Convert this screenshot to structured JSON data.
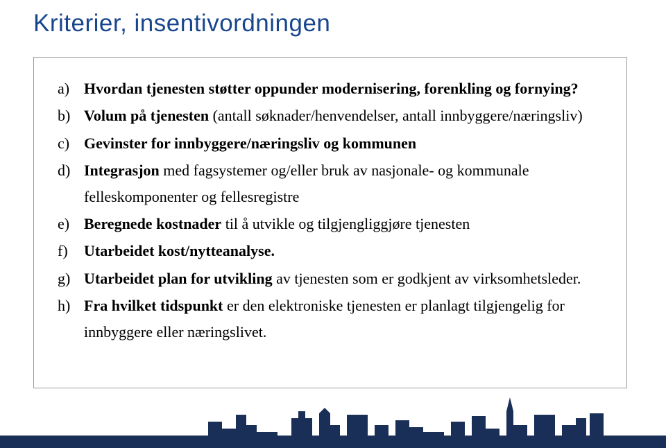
{
  "title": "Kriterier, insentivordningen",
  "items": [
    {
      "marker": "a)",
      "prefix": "",
      "bold": "Hvordan tjenesten støtter oppunder modernisering, forenkling og fornying?",
      "suffix": ""
    },
    {
      "marker": "b)",
      "prefix": "",
      "bold": "Volum på tjenesten",
      "suffix": " (antall søknader/henvendelser, antall innbyggere/næringsliv)"
    },
    {
      "marker": "c)",
      "prefix": "",
      "bold": "Gevinster for innbyggere/næringsliv og kommunen",
      "suffix": ""
    },
    {
      "marker": "d)",
      "prefix": "",
      "bold": "Integrasjon",
      "suffix": " med fagsystemer og/eller bruk av nasjonale- og kommunale felleskomponenter og fellesregistre"
    },
    {
      "marker": "e)",
      "prefix": "",
      "bold": "Beregnede kostnader",
      "suffix": " til å utvikle og tilgjengliggjøre tjenesten"
    },
    {
      "marker": "f)",
      "prefix": "",
      "bold": "Utarbeidet kost/nytteanalyse.",
      "suffix": ""
    },
    {
      "marker": "g)",
      "prefix": "",
      "bold": "Utarbeidet plan for utvikling",
      "suffix": " av tjenesten som er godkjent av virksomhetsleder."
    },
    {
      "marker": "h)",
      "prefix": "",
      "bold": "Fra hvilket tidspunkt",
      "suffix": " er den elektroniske tjenesten er planlagt tilgjengelig for innbyggere eller næringslivet."
    }
  ]
}
